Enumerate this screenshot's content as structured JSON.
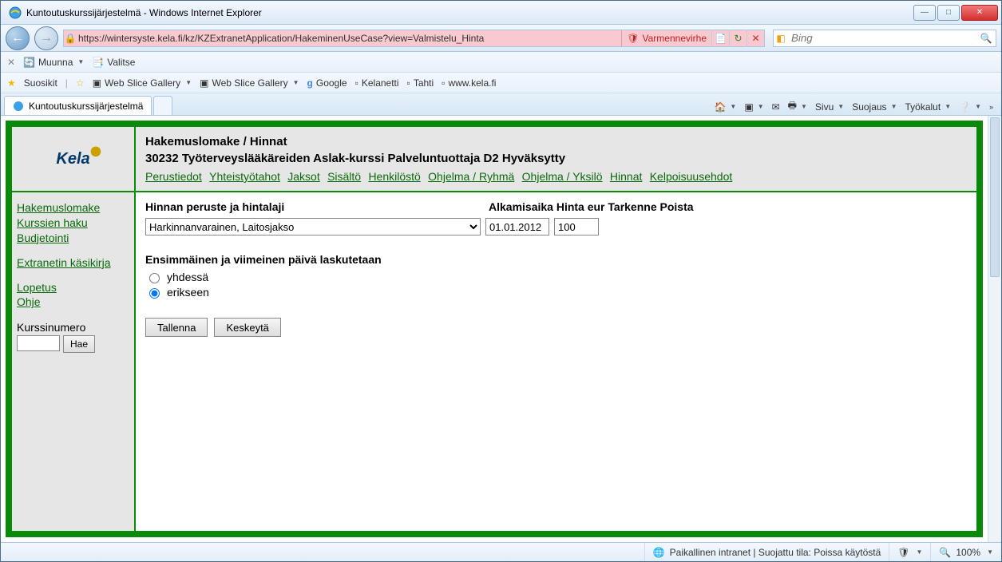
{
  "window": {
    "title": "Kuntoutuskurssijärjestelmä - Windows Internet Explorer"
  },
  "nav": {
    "url": "https://wintersyste.kela.fi/kz/KZExtranetApplication/HakeminenUseCase?view=Valmistelu_Hinta",
    "cert_error": "Varmennevirhe",
    "search_placeholder": "Bing"
  },
  "toolbar1": {
    "muunna": "Muunna",
    "valitse": "Valitse"
  },
  "toolbar2": {
    "suosikit": "Suosikit",
    "items": [
      "Web Slice Gallery",
      "Web Slice Gallery",
      "Google",
      "Kelanetti",
      "Tahti",
      "www.kela.fi"
    ]
  },
  "tab": {
    "label": "Kuntoutuskurssijärjestelmä"
  },
  "ie_menu": {
    "sivu": "Sivu",
    "suojaus": "Suojaus",
    "tyokalut": "Työkalut"
  },
  "page": {
    "logo": "Kela",
    "heading1": "Hakemuslomake / Hinnat",
    "heading2": "30232 Työterveyslääkäreiden Aslak-kurssi Palveluntuottaja D2 Hyväksytty",
    "top_links": [
      "Perustiedot",
      "Yhteistyötahot",
      "Jaksot",
      "Sisältö",
      "Henkilöstö",
      "Ohjelma / Ryhmä",
      "Ohjelma / Yksilö",
      "Hinnat",
      "Kelpoisuusehdot"
    ],
    "side_links_1": [
      "Hakemuslomake",
      "Kurssien haku",
      "Budjetointi"
    ],
    "side_links_2": [
      "Extranetin käsikirja"
    ],
    "side_links_3": [
      "Lopetus",
      "Ohje"
    ],
    "kurssinumero_label": "Kurssinumero",
    "hae_label": "Hae",
    "col1": "Hinnan peruste ja hintalaji",
    "col2": "Alkamisaika Hinta eur Tarkenne Poista",
    "select_value": "Harkinnanvarainen, Laitosjakso",
    "date_value": "01.01.2012",
    "price_value": "100",
    "billing_title": "Ensimmäinen ja viimeinen päivä laskutetaan",
    "radio1": "yhdessä",
    "radio2": "erikseen",
    "save": "Tallenna",
    "cancel": "Keskeytä"
  },
  "status": {
    "zone": "Paikallinen intranet | Suojattu tila: Poissa käytöstä",
    "zoom": "100%"
  }
}
